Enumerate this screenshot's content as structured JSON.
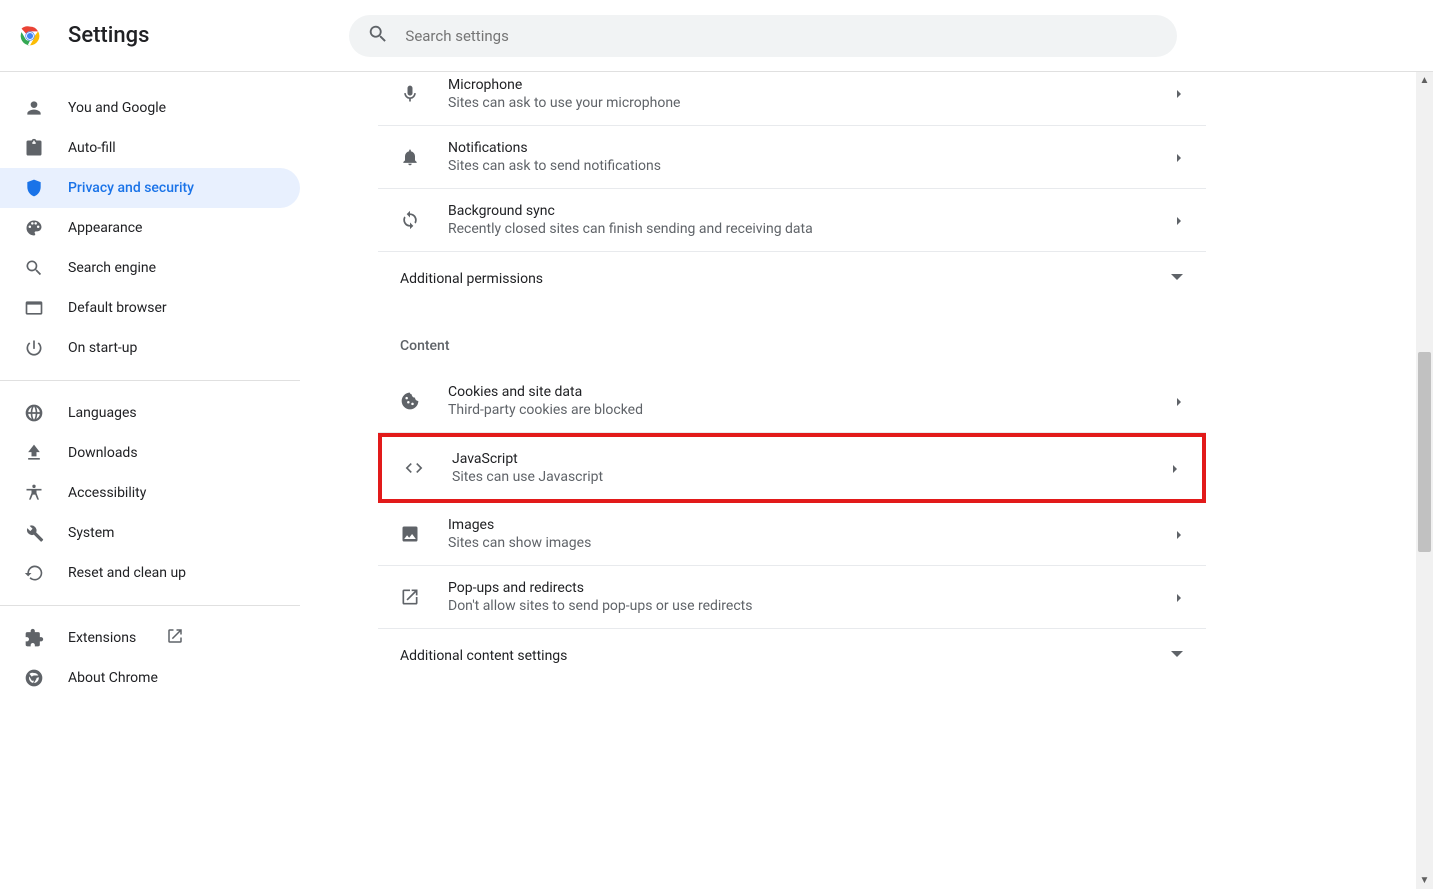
{
  "header": {
    "title": "Settings",
    "search_placeholder": "Search settings"
  },
  "sidebar": {
    "group1": [
      {
        "id": "you",
        "label": "You and Google"
      },
      {
        "id": "autofill",
        "label": "Auto-fill"
      },
      {
        "id": "privacy",
        "label": "Privacy and security",
        "active": true
      },
      {
        "id": "appearance",
        "label": "Appearance"
      },
      {
        "id": "search",
        "label": "Search engine"
      },
      {
        "id": "default",
        "label": "Default browser"
      },
      {
        "id": "startup",
        "label": "On start-up"
      }
    ],
    "group2": [
      {
        "id": "languages",
        "label": "Languages"
      },
      {
        "id": "downloads",
        "label": "Downloads"
      },
      {
        "id": "accessibility",
        "label": "Accessibility"
      },
      {
        "id": "system",
        "label": "System"
      },
      {
        "id": "reset",
        "label": "Reset and clean up"
      }
    ],
    "group3": [
      {
        "id": "extensions",
        "label": "Extensions"
      },
      {
        "id": "about",
        "label": "About Chrome"
      }
    ]
  },
  "permissions": [
    {
      "id": "microphone",
      "title": "Microphone",
      "sub": "Sites can ask to use your microphone"
    },
    {
      "id": "notifications",
      "title": "Notifications",
      "sub": "Sites can ask to send notifications"
    },
    {
      "id": "backgroundsync",
      "title": "Background sync",
      "sub": "Recently closed sites can finish sending and receiving data"
    }
  ],
  "additional_permissions_label": "Additional permissions",
  "content_section_label": "Content",
  "content": [
    {
      "id": "cookies",
      "title": "Cookies and site data",
      "sub": "Third-party cookies are blocked"
    },
    {
      "id": "javascript",
      "title": "JavaScript",
      "sub": "Sites can use Javascript",
      "highlight": true
    },
    {
      "id": "images",
      "title": "Images",
      "sub": "Sites can show images"
    },
    {
      "id": "popups",
      "title": "Pop-ups and redirects",
      "sub": "Don't allow sites to send pop-ups or use redirects"
    }
  ],
  "additional_content_label": "Additional content settings"
}
